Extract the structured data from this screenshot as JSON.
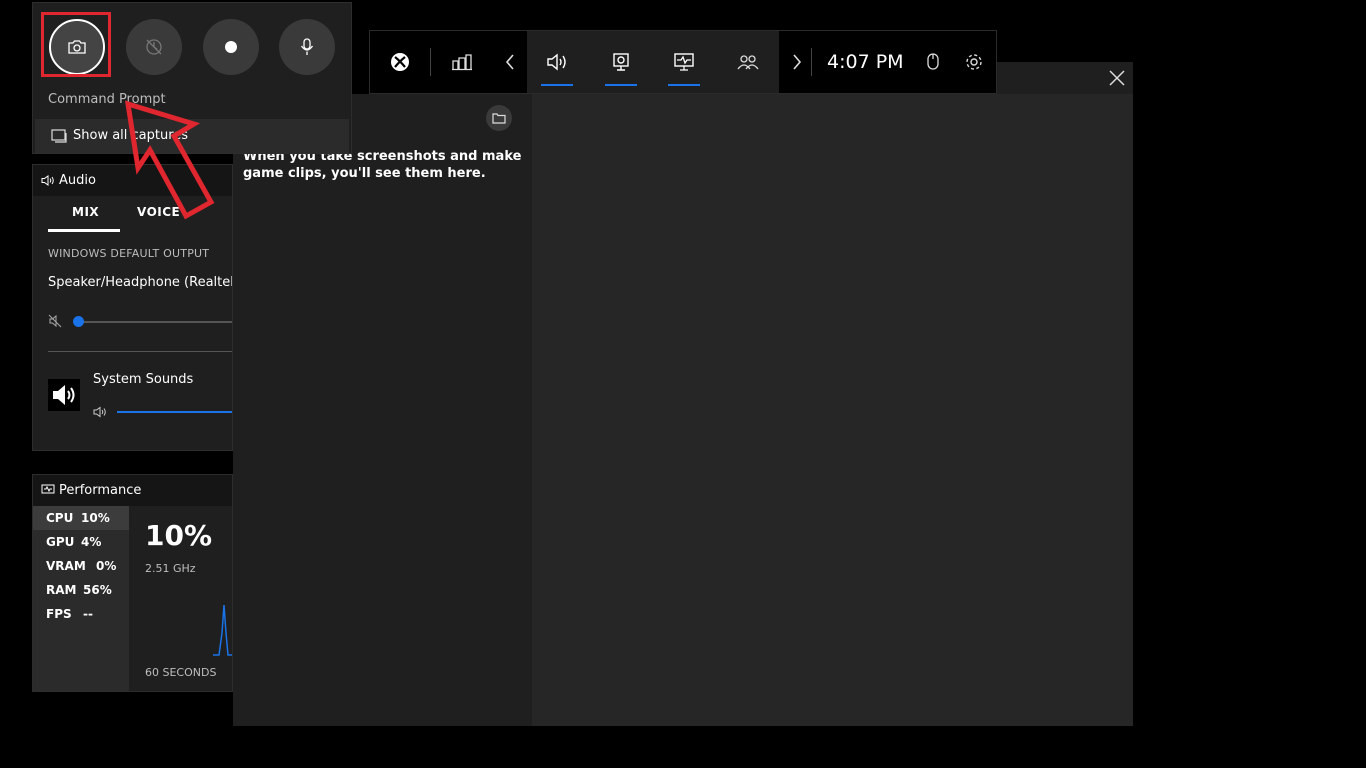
{
  "capture": {
    "buttons": [
      {
        "name": "screenshot",
        "icon": "camera-icon"
      },
      {
        "name": "record-last",
        "icon": "record-last-icon"
      },
      {
        "name": "start-recording",
        "icon": "record-dot-icon"
      },
      {
        "name": "mic",
        "icon": "microphone-icon"
      }
    ],
    "app_name": "Command Prompt",
    "show_all": "Show all captures"
  },
  "audio": {
    "title": "Audio",
    "tabs": [
      "MIX",
      "VOICE"
    ],
    "active_tab": "MIX",
    "section_label": "WINDOWS DEFAULT OUTPUT",
    "device": "Speaker/Headphone (Realtek",
    "master_volume": 0,
    "app": {
      "name": "System Sounds",
      "volume": 100
    }
  },
  "performance": {
    "title": "Performance",
    "metrics": [
      {
        "key": "CPU",
        "value": "10%"
      },
      {
        "key": "GPU",
        "value": "4%"
      },
      {
        "key": "VRAM",
        "value": "0%"
      },
      {
        "key": "RAM",
        "value": "56%"
      },
      {
        "key": "FPS",
        "value": "--"
      }
    ],
    "selected": "CPU",
    "big_value": "10%",
    "frequency": "2.51 GHz",
    "window_label": "60 SECONDS"
  },
  "topbar": {
    "icons": [
      "xbox-icon",
      "widget-menu-icon",
      "chevron-left-icon",
      "audio-icon",
      "capture-icon",
      "performance-icon",
      "xbox-social-icon",
      "chevron-right-icon",
      "mouse-icon",
      "settings-icon"
    ],
    "time": "4:07 PM"
  },
  "gallery": {
    "empty_text": "When you take screenshots and make game clips, you'll see them here."
  },
  "colors": {
    "accent": "#1a73e8",
    "highlight": "#e0262e"
  }
}
